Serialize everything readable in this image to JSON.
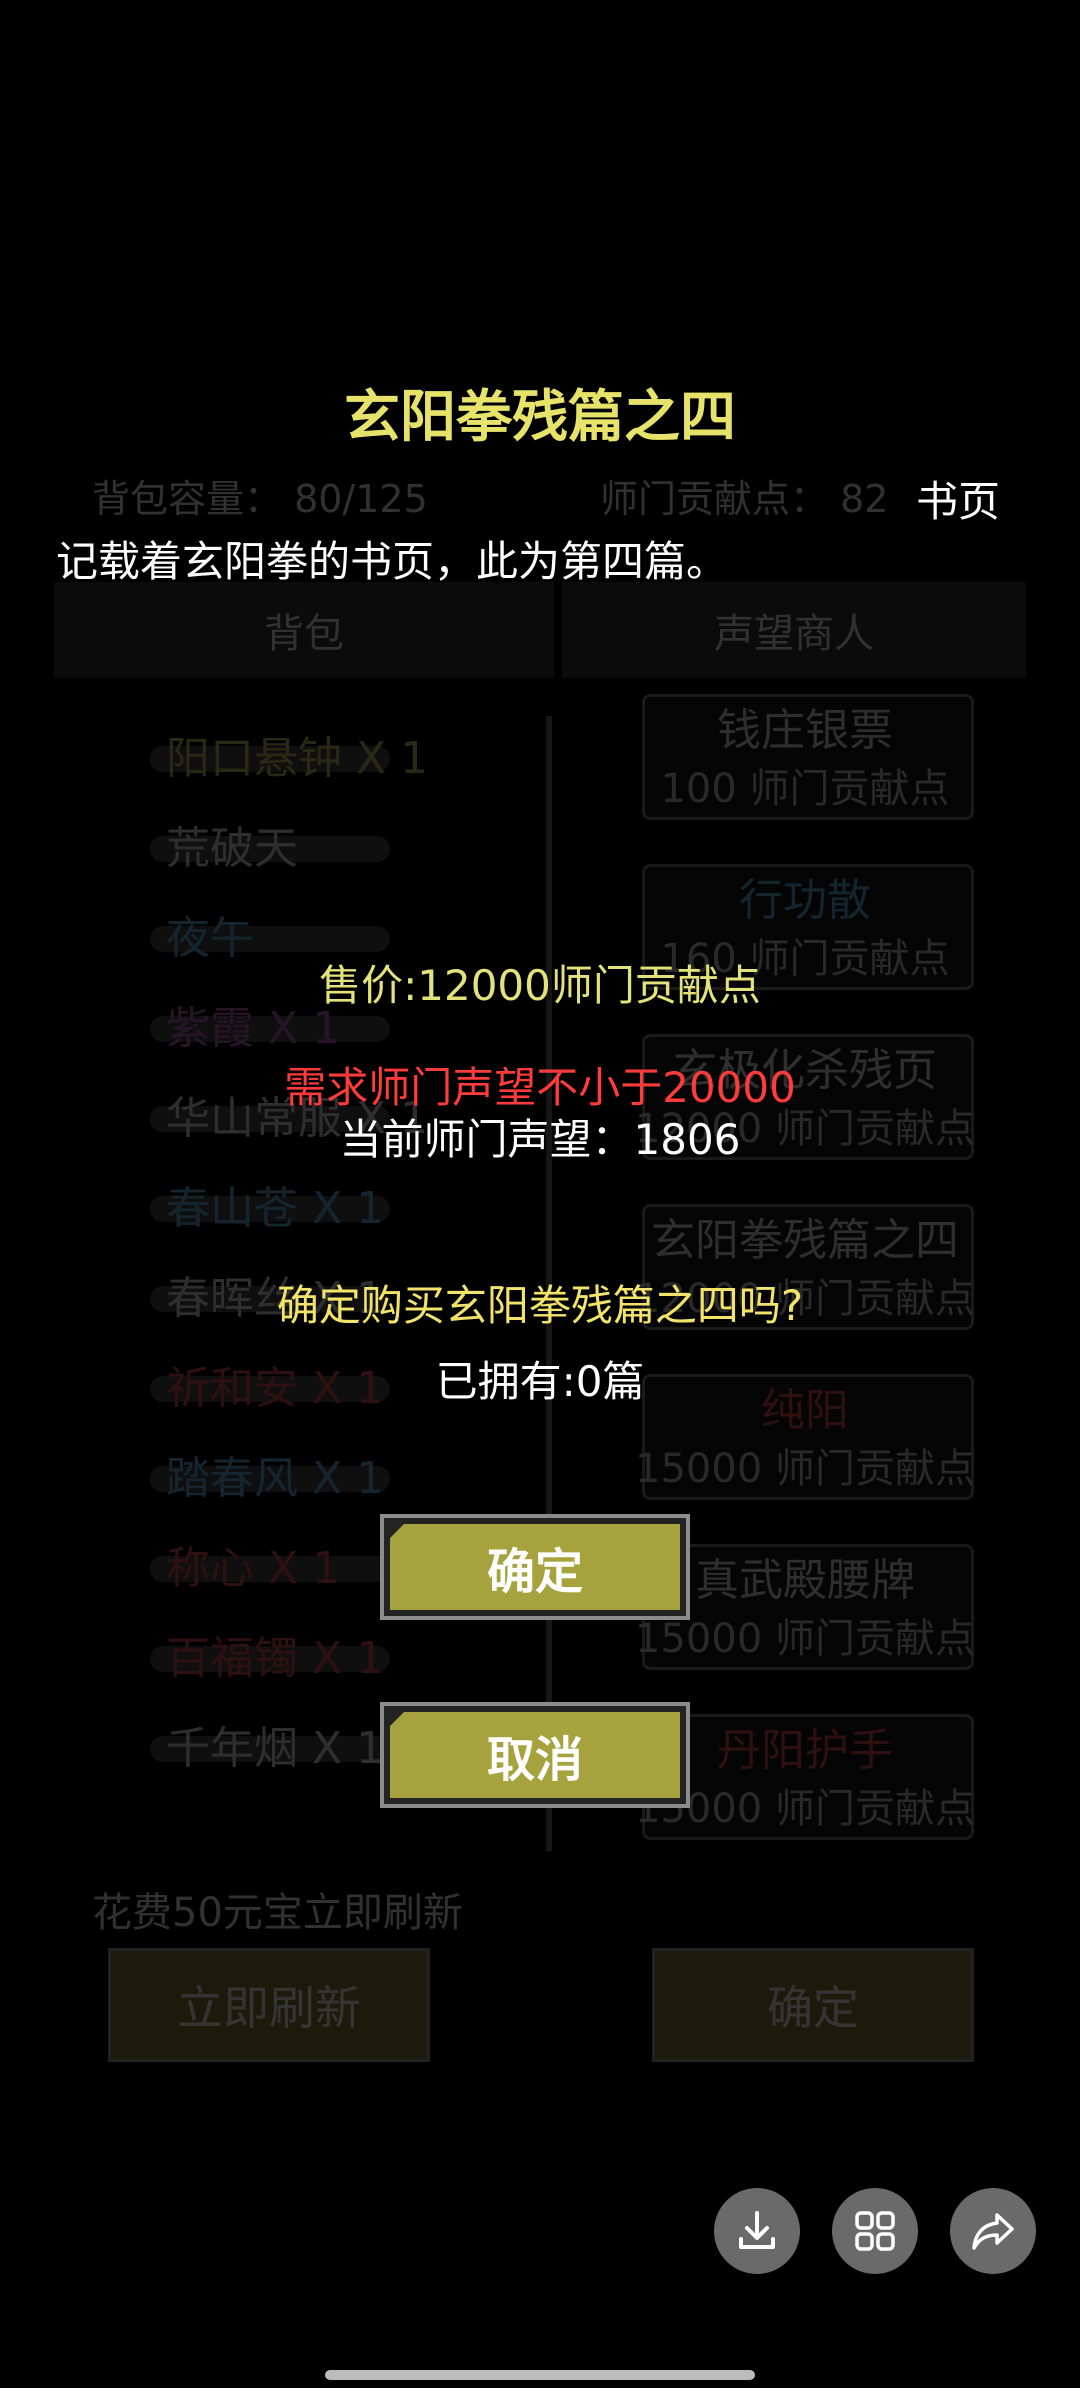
{
  "background_shop": {
    "bag_capacity": "背包容量： 80/125",
    "contribution_points": "师门贡献点： 82",
    "tabs": [
      "背包",
      "声望商人"
    ],
    "inventory_items": [
      {
        "label": "阳口悬钟 X 1",
        "color": "#b5b85a"
      },
      {
        "label": "荒破天",
        "color": "#d0d0d0"
      },
      {
        "label": "夜午",
        "color": "#5aa7d6"
      },
      {
        "label": "紫霞 X 1",
        "color": "#b05ab5"
      },
      {
        "label": "华山常服 X 1",
        "color": "#cfcfcf"
      },
      {
        "label": "春山苍 X 1",
        "color": "#5aa7d6"
      },
      {
        "label": "春晖丝 X 1",
        "color": "#cfcfcf"
      },
      {
        "label": "祈和安 X 1",
        "color": "#d14b4b"
      },
      {
        "label": "踏春风 X 1",
        "color": "#5aa7d6"
      },
      {
        "label": "称心 X 1",
        "color": "#d14b4b"
      },
      {
        "label": "百福镯 X 1",
        "color": "#d14b4b"
      },
      {
        "label": "千年烟 X 1",
        "color": "#cfcfcf"
      }
    ],
    "shop_items": [
      {
        "name": "钱庄银票",
        "price": "100 师门贡献点",
        "color": "#cfcfcf"
      },
      {
        "name": "行功散",
        "price": "160 师门贡献点",
        "color": "#5aa7d6"
      },
      {
        "name": "玄极化杀残页",
        "price": "12000 师门贡献点",
        "color": "#cfcfcf"
      },
      {
        "name": "玄阳拳残篇之四",
        "price": "12000 师门贡献点",
        "color": "#cfcfcf"
      },
      {
        "name": "纯阳",
        "price": "15000 师门贡献点",
        "color": "#d14b4b"
      },
      {
        "name": "真武殿腰牌",
        "price": "15000 师门贡献点",
        "color": "#cfcfcf"
      },
      {
        "name": "丹阳护手",
        "price": "15000 师门贡献点",
        "color": "#d14b4b"
      }
    ],
    "refresh_cost": "花费50元宝立即刷新",
    "refresh_button": "立即刷新",
    "confirm_button": "确定"
  },
  "dialog": {
    "title": "玄阳拳残篇之四",
    "type_label": "书页",
    "description": "记载着玄阳拳的书页，此为第四篇。",
    "price": "售价:12000师门贡献点",
    "requirement": "需求师门声望不小于20000",
    "current_reputation": "当前师门声望：1806",
    "confirm_question": "确定购买玄阳拳残篇之四吗?",
    "owned": "已拥有:0篇",
    "confirm_button": "确定",
    "cancel_button": "取消"
  },
  "floating_actions": [
    "download-icon",
    "grid-icon",
    "share-icon"
  ],
  "colors": {
    "title_yellow": "#e7e36a",
    "requirement_red": "#ff3b3b",
    "button_olive": "#a6a23e"
  }
}
